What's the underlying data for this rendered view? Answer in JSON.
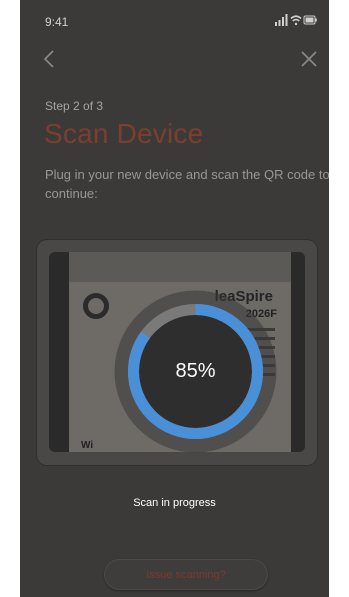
{
  "status_bar": {
    "time": "9:41",
    "icons": [
      "signal-icon",
      "wifi-icon",
      "battery-icon"
    ]
  },
  "nav": {
    "back_icon": "chevron-left-icon",
    "close_icon": "close-icon"
  },
  "header": {
    "step": "Step 2 of 3",
    "title": "Scan Device",
    "description": "Plug in your new device and scan the QR code to continue:"
  },
  "camera_preview": {
    "brand_text": "leaSpire",
    "model_text": "2026F",
    "badge_text": "Wi"
  },
  "progress": {
    "percent_label": "85%",
    "percent_value": 0.85
  },
  "status": {
    "text": "Scan in progress"
  },
  "actions": {
    "issue_label": "Issue scanning?"
  },
  "colors": {
    "overlay": "#3c3a39",
    "accent": "#4a90d9",
    "title": "#7b3f2d",
    "track": "#7a7a7a"
  }
}
